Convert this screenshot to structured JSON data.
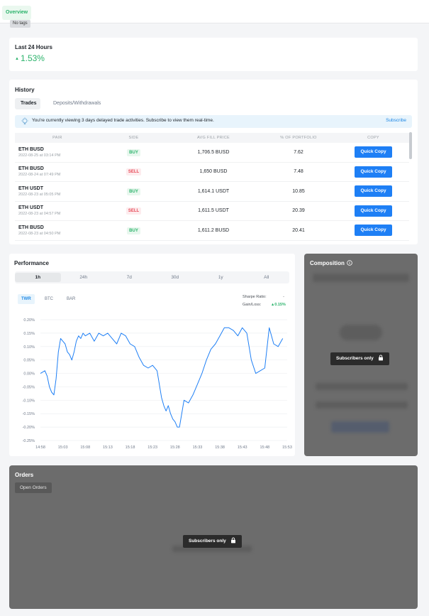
{
  "nav": {
    "overview_tab": "Overview"
  },
  "tag": "No tags",
  "last24": {
    "title": "Last 24 Hours",
    "value": "1.53%"
  },
  "history": {
    "title": "History",
    "tabs": [
      "Trades",
      "Deposits/Withdrawals"
    ],
    "notice": "You're currently viewing 3 days delayed trade activities. Subscribe to view them real-time.",
    "subscribe": "Subscribe",
    "columns": [
      "PAIR",
      "SIDE",
      "AVG FILL PRICE",
      "% OF PORTFOLIO",
      "COPY"
    ],
    "copy_label": "Quick Copy",
    "rows": [
      {
        "pair": "ETH BUSD",
        "date": "2022-08-25 at 03:14 PM",
        "side": "BUY",
        "price": "1,706.5 BUSD",
        "pct": "7.62"
      },
      {
        "pair": "ETH BUSD",
        "date": "2022-08-24 at 07:49 PM",
        "side": "SELL",
        "price": "1,650 BUSD",
        "pct": "7.48"
      },
      {
        "pair": "ETH USDT",
        "date": "2022-08-23 at 05:05 PM",
        "side": "BUY",
        "price": "1,614.1 USDT",
        "pct": "10.85"
      },
      {
        "pair": "ETH USDT",
        "date": "2022-08-23 at 04:57 PM",
        "side": "SELL",
        "price": "1,611.5 USDT",
        "pct": "20.39"
      },
      {
        "pair": "ETH BUSD",
        "date": "2022-08-23 at 04:50 PM",
        "side": "BUY",
        "price": "1,611.2 BUSD",
        "pct": "20.41"
      }
    ]
  },
  "performance": {
    "title": "Performance",
    "ranges": [
      "1h",
      "24h",
      "7d",
      "30d",
      "1y",
      "All"
    ],
    "modes": [
      "TWR",
      "BTC",
      "BAR"
    ],
    "sharpe_label": "Sharpe Ratio:",
    "sharpe_value": "-",
    "gain_label": "Gain/Loss:",
    "gain_value": "0.15%"
  },
  "chart_data": {
    "type": "line",
    "title": "",
    "xlabel": "",
    "ylabel": "",
    "x_ticks": [
      "14:58",
      "15:03",
      "15:08",
      "15:13",
      "15:18",
      "15:23",
      "15:28",
      "15:33",
      "15:38",
      "15:43",
      "15:48",
      "15:53"
    ],
    "y_ticks": [
      "0.20%",
      "0.15%",
      "0.10%",
      "0.05%",
      "0.00%",
      "-0.05%",
      "-0.10%",
      "-0.15%",
      "-0.20%",
      "-0.25%"
    ],
    "ylim": [
      -0.25,
      0.2
    ],
    "xlim": [
      0,
      55
    ],
    "grid": true,
    "series": [
      {
        "x": [
          0,
          1,
          1.5,
          2,
          2.5,
          3,
          3.5,
          4,
          4.5,
          5,
          5.5,
          6,
          6.5,
          7,
          7.5,
          8,
          8.5,
          9,
          9.5,
          10,
          11,
          12,
          13,
          14,
          15,
          16,
          17,
          18,
          19,
          20,
          21,
          22,
          23,
          24,
          25,
          26,
          27,
          27.5,
          28,
          28.5,
          29,
          29.5,
          30,
          30.5,
          31,
          32,
          33,
          34,
          35,
          36,
          37,
          38,
          39,
          40,
          41,
          42,
          43,
          44,
          45,
          46,
          47,
          48,
          49,
          50,
          51,
          52,
          53,
          54
        ],
        "y": [
          0.0,
          0.01,
          -0.01,
          -0.05,
          -0.07,
          -0.08,
          -0.02,
          0.08,
          0.13,
          0.12,
          0.11,
          0.08,
          0.07,
          0.05,
          0.08,
          0.12,
          0.14,
          0.13,
          0.15,
          0.14,
          0.15,
          0.12,
          0.15,
          0.14,
          0.15,
          0.13,
          0.11,
          0.15,
          0.14,
          0.11,
          0.1,
          0.06,
          0.03,
          0.02,
          0.03,
          0.01,
          -0.09,
          -0.12,
          -0.14,
          -0.12,
          -0.15,
          -0.17,
          -0.18,
          -0.2,
          -0.2,
          -0.1,
          -0.11,
          -0.08,
          -0.04,
          0.0,
          0.05,
          0.09,
          0.11,
          0.14,
          0.17,
          0.17,
          0.16,
          0.14,
          0.17,
          0.15,
          0.05,
          0.0,
          0.01,
          0.02,
          0.17,
          0.11,
          0.1,
          0.13
        ]
      }
    ]
  },
  "composition": {
    "title": "Composition",
    "locked": "Subscribers only"
  },
  "orders": {
    "title": "Orders",
    "tab": "Open Orders",
    "locked": "Subscribers only"
  }
}
